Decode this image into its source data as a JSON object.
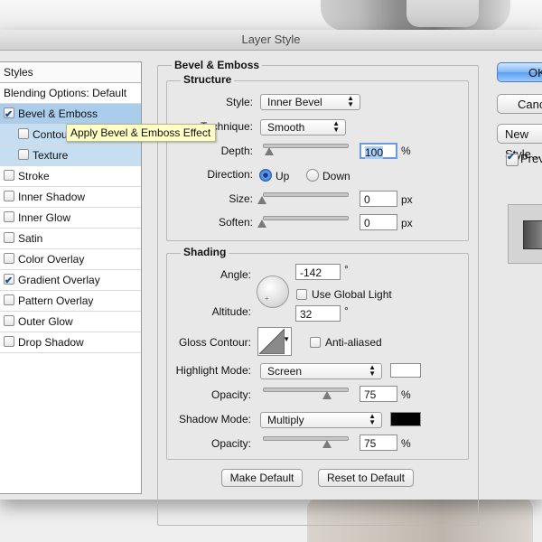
{
  "dialog": {
    "title": "Layer Style"
  },
  "styles_list": {
    "header": "Styles",
    "blending": "Blending Options: Default",
    "items": [
      {
        "label": "Bevel & Emboss",
        "checked": true,
        "selected": true
      },
      {
        "label": "Contour",
        "checked": false,
        "sub": true
      },
      {
        "label": "Texture",
        "checked": false,
        "sub": true
      },
      {
        "label": "Stroke",
        "checked": false
      },
      {
        "label": "Inner Shadow",
        "checked": false
      },
      {
        "label": "Inner Glow",
        "checked": false
      },
      {
        "label": "Satin",
        "checked": false
      },
      {
        "label": "Color Overlay",
        "checked": false
      },
      {
        "label": "Gradient Overlay",
        "checked": true
      },
      {
        "label": "Pattern Overlay",
        "checked": false
      },
      {
        "label": "Outer Glow",
        "checked": false
      },
      {
        "label": "Drop Shadow",
        "checked": false
      }
    ]
  },
  "tooltip": "Apply Bevel & Emboss Effect",
  "bevel": {
    "title": "Bevel & Emboss",
    "structure_title": "Structure",
    "style_label": "Style:",
    "style_value": "Inner Bevel",
    "technique_label": "Technique:",
    "technique_value": "Smooth",
    "depth_label": "Depth:",
    "depth_value": "100",
    "depth_unit": "%",
    "direction_label": "Direction:",
    "direction_up": "Up",
    "direction_down": "Down",
    "direction_selected": "Up",
    "size_label": "Size:",
    "size_value": "0",
    "size_unit": "px",
    "soften_label": "Soften:",
    "soften_value": "0",
    "soften_unit": "px"
  },
  "shading": {
    "title": "Shading",
    "angle_label": "Angle:",
    "angle_value": "-142",
    "angle_unit": "°",
    "global_light_label": "Use Global Light",
    "global_light_checked": false,
    "altitude_label": "Altitude:",
    "altitude_value": "32",
    "altitude_unit": "°",
    "gloss_label": "Gloss Contour:",
    "anti_aliased_label": "Anti-aliased",
    "anti_aliased_checked": false,
    "highlight_mode_label": "Highlight Mode:",
    "highlight_mode_value": "Screen",
    "highlight_color": "#ffffff",
    "highlight_opacity_label": "Opacity:",
    "highlight_opacity_value": "75",
    "highlight_opacity_unit": "%",
    "shadow_mode_label": "Shadow Mode:",
    "shadow_mode_value": "Multiply",
    "shadow_color": "#000000",
    "shadow_opacity_label": "Opacity:",
    "shadow_opacity_value": "75",
    "shadow_opacity_unit": "%"
  },
  "buttons": {
    "make_default": "Make Default",
    "reset_default": "Reset to Default",
    "ok": "OK",
    "cancel": "Cancel",
    "new_style": "New Style...",
    "preview": "Preview"
  }
}
